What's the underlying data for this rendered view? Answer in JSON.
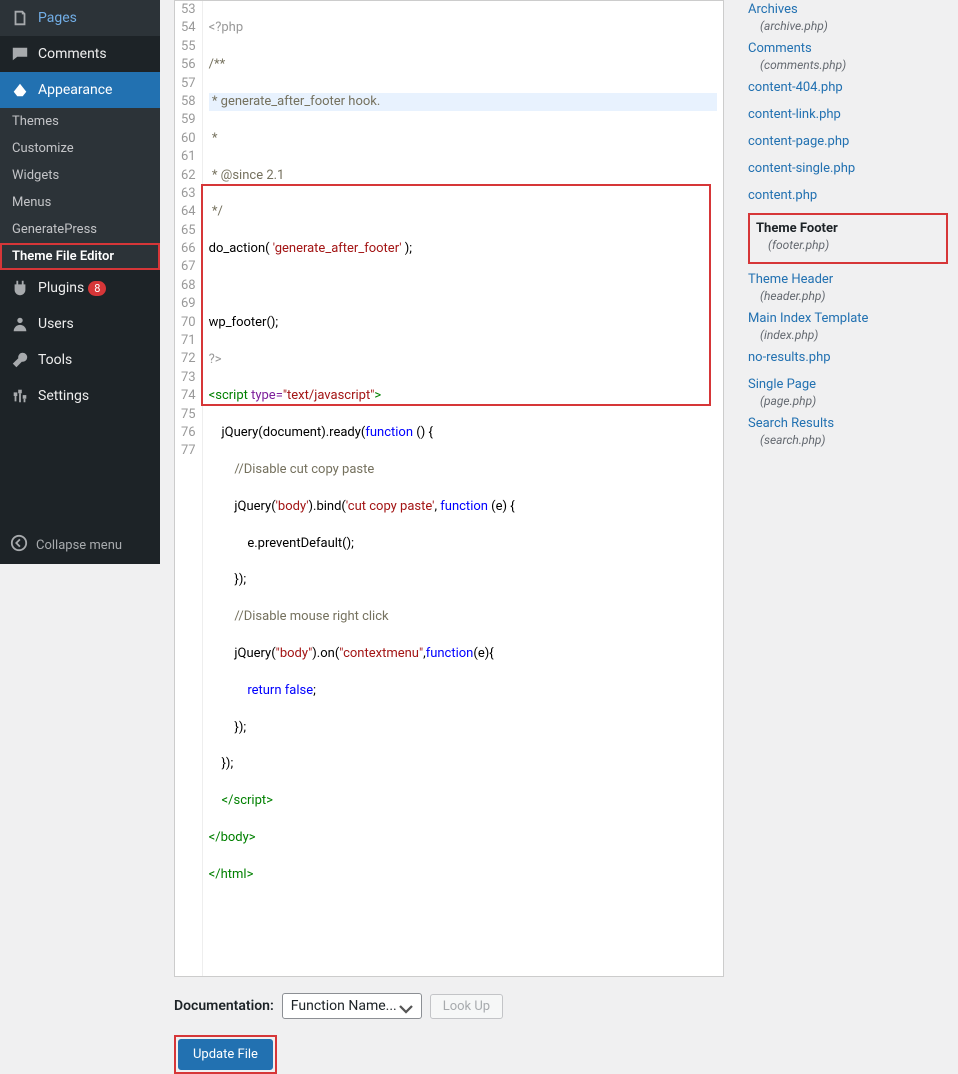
{
  "sidebar": {
    "pages": "Pages",
    "comments": "Comments",
    "appearance": "Appearance",
    "plugins": "Plugins",
    "plugins_badge": "8",
    "users": "Users",
    "tools": "Tools",
    "settings": "Settings",
    "collapse": "Collapse menu",
    "submenu": {
      "themes": "Themes",
      "customize": "Customize",
      "widgets": "Widgets",
      "menus": "Menus",
      "generatepress": "GeneratePress",
      "theme_file_editor": "Theme File Editor"
    }
  },
  "code_lines": [
    "53",
    "54",
    "55",
    "56",
    "57",
    "58",
    "59",
    "60",
    "61",
    "62",
    "63",
    "64",
    "65",
    "66",
    "67",
    "68",
    "69",
    "70",
    "71",
    "72",
    "73",
    "74",
    "75",
    "76",
    "77"
  ],
  "code": {
    "l53": "<?php",
    "l54": "/**",
    "l55": " * generate_after_footer hook.",
    "l56": " *",
    "l57": " * @since 2.1",
    "l58": " */",
    "l59a": "do_action( ",
    "l59b": "'generate_after_footer'",
    "l59c": " );",
    "l61": "wp_footer();",
    "l62": "?>",
    "l63a": "<script",
    "l63b": " type=",
    "l63c": "\"text/javascript\"",
    "l63d": ">",
    "l64": "    jQuery(document).ready(",
    "l64b": "function",
    "l64c": " () {",
    "l65": "        //Disable cut copy paste",
    "l66a": "        jQuery(",
    "l66b": "'body'",
    "l66c": ").bind(",
    "l66d": "'cut copy paste'",
    "l66e": ", ",
    "l66f": "function",
    "l66g": " (e) {",
    "l67": "            e.preventDefault();",
    "l68": "        });",
    "l69": "        //Disable mouse right click",
    "l70a": "        jQuery(",
    "l70b": "\"body\"",
    "l70c": ").on(",
    "l70d": "\"contextmenu\"",
    "l70e": ",",
    "l70f": "function",
    "l70g": "(e){",
    "l71a": "            return",
    "l71b": " false",
    "l71c": ";",
    "l72": "        });",
    "l73": "    });",
    "l74": "    </script>",
    "l75": "</body>",
    "l76": "</html>"
  },
  "doc_label": "Documentation:",
  "func_select": "Function Name...",
  "lookup": "Look Up",
  "update_file": "Update File",
  "files": {
    "archives": "Archives",
    "archives_f": "(archive.php)",
    "comments": "Comments",
    "comments_f": "(comments.php)",
    "content404": "content-404.php",
    "contentlink": "content-link.php",
    "contentpage": "content-page.php",
    "contentsingle": "content-single.php",
    "contentphp": "content.php",
    "themefooter": "Theme Footer",
    "themefooter_f": "(footer.php)",
    "themeheader": "Theme Header",
    "themeheader_f": "(header.php)",
    "mainindex": "Main Index Template",
    "mainindex_f": "(index.php)",
    "noresults": "no-results.php",
    "singlepage": "Single Page",
    "singlepage_f": "(page.php)",
    "searchresults": "Search Results",
    "searchresults_f": "(search.php)"
  }
}
